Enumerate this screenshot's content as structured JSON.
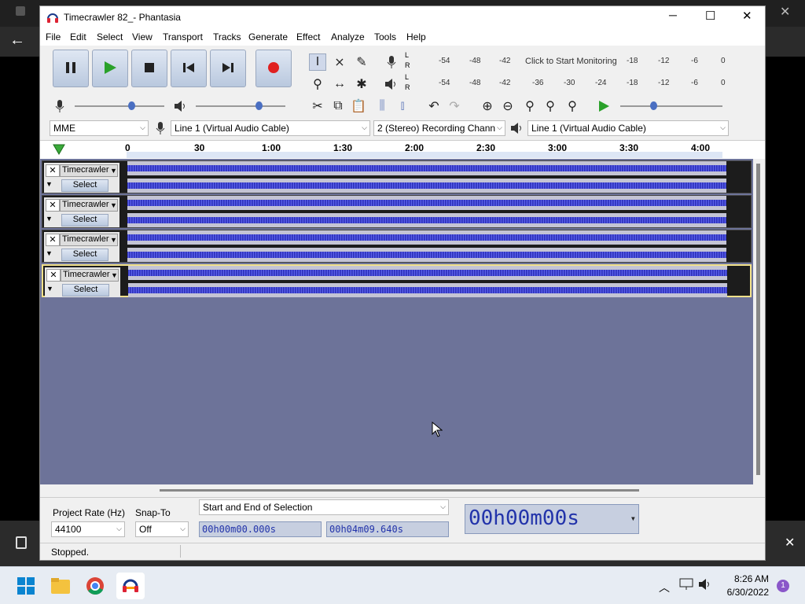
{
  "window": {
    "title": "Timecrawler 82_- Phantasia"
  },
  "menu": [
    "File",
    "Edit",
    "Select",
    "View",
    "Transport",
    "Tracks",
    "Generate",
    "Effect",
    "Analyze",
    "Tools",
    "Help"
  ],
  "meter": {
    "rec_scale": [
      "-54",
      "-48",
      "-42",
      "Click to Start Monitoring",
      "-18",
      "-12",
      "-6",
      "0"
    ],
    "play_scale": [
      "-54",
      "-48",
      "-42",
      "-36",
      "-30",
      "-24",
      "-18",
      "-12",
      "-6",
      "0"
    ],
    "rec_letters": [
      "L",
      "R"
    ],
    "play_letters": [
      "L",
      "R"
    ]
  },
  "device": {
    "host": "MME",
    "rec_device": "Line 1 (Virtual Audio Cable)",
    "channels": "2 (Stereo) Recording Chann",
    "play_device": "Line 1 (Virtual Audio Cable)"
  },
  "ruler": {
    "ticks": [
      "0",
      "30",
      "1:00",
      "1:30",
      "2:00",
      "2:30",
      "3:00",
      "3:30",
      "4:00"
    ]
  },
  "tracks": [
    {
      "name": "Timecrawler",
      "select": "Select"
    },
    {
      "name": "Timecrawler",
      "select": "Select"
    },
    {
      "name": "Timecrawler",
      "select": "Select"
    },
    {
      "name": "Timecrawler",
      "select": "Select"
    }
  ],
  "selection": {
    "rate_label": "Project Rate (Hz)",
    "rate_value": "44100",
    "snap_label": "Snap-To",
    "snap_value": "Off",
    "mode": "Start and End of Selection",
    "start": "00h00m00.000s",
    "end": "00h04m09.640s",
    "big_time": "00h00m00s"
  },
  "status": "Stopped.",
  "clock": {
    "time": "8:26 AM",
    "date": "6/30/2022"
  },
  "notif_count": "1",
  "symbols": {
    "close": "✕",
    "min": "─",
    "max": "☐",
    "menu_caret": "▼",
    "combo_caret": "⌵",
    "big_caret": "▾"
  }
}
